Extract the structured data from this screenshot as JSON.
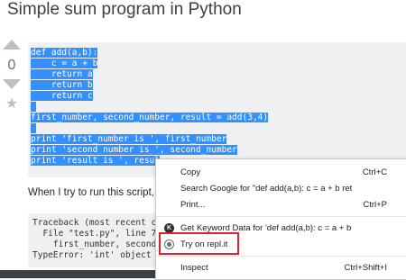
{
  "question": {
    "title": "Simple sum program in Python",
    "score": "0"
  },
  "code_block": {
    "lines": [
      "def add(a,b):",
      "    c = a + b",
      "    return a",
      "    return b",
      "    return c",
      "",
      "first_number, second_number, result = add(3,4)",
      "",
      "print 'first_number is ', first_number",
      "print 'second number is ', second_number",
      "print 'result is ', resul"
    ]
  },
  "body_text": "When I try to run this script,",
  "traceback": {
    "lines": [
      "Traceback (most recent ca",
      "  File \"test.py\", line 7,",
      "    first_number, second_",
      "TypeError: 'int' object i"
    ]
  },
  "context_menu": {
    "copy_label": "Copy",
    "copy_shortcut": "Ctrl+C",
    "search_label": "Search Google for \"def add(a,b):    c = a + b    ret",
    "print_label": "Print...",
    "print_shortcut": "Ctrl+P",
    "keyword_label": "Get Keyword Data for 'def add(a,b):    c = a + b",
    "repl_label": "Try on repl.it",
    "inspect_label": "Inspect",
    "inspect_shortcut": "Ctrl+Shift+I"
  },
  "colors": {
    "selection": "#3390ff",
    "code_background": "#eff0f1",
    "highlight_border": "#e0202e"
  },
  "icons": [
    "upvote-arrow-icon",
    "downvote-arrow-icon",
    "favorite-star-icon",
    "keyword-extension-icon",
    "repl-it-icon"
  ]
}
